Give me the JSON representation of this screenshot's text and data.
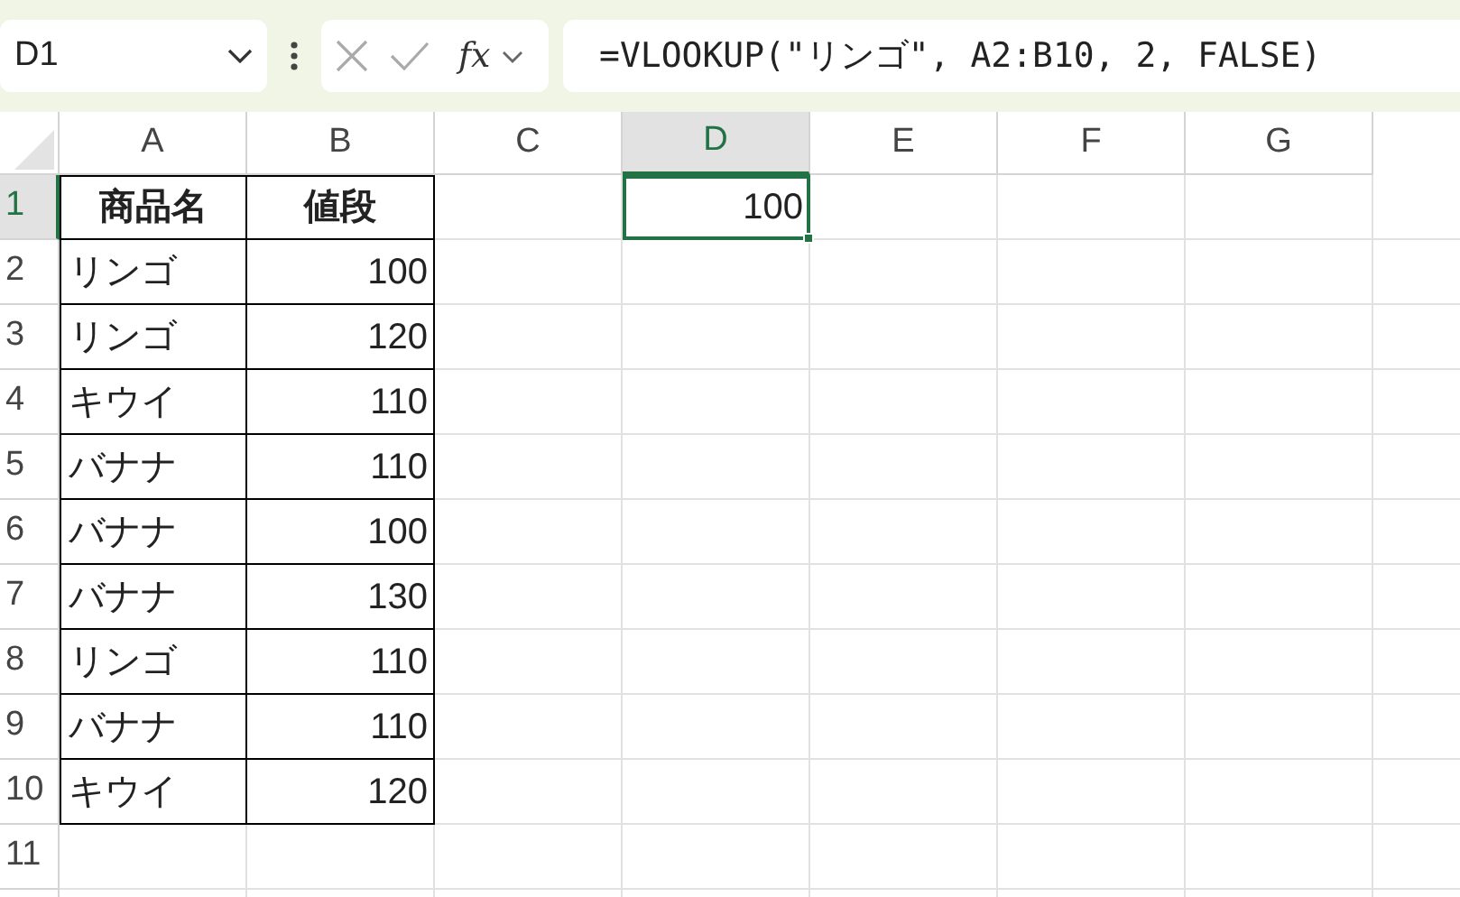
{
  "name_box": {
    "value": "D1"
  },
  "formula_bar": {
    "function_button": "fx",
    "formula": "=VLOOKUP(\"リンゴ\", A2:B10, 2, FALSE)"
  },
  "columns": [
    {
      "label": "A",
      "selected": false
    },
    {
      "label": "B",
      "selected": false
    },
    {
      "label": "C",
      "selected": false
    },
    {
      "label": "D",
      "selected": true
    },
    {
      "label": "E",
      "selected": false
    },
    {
      "label": "F",
      "selected": false
    },
    {
      "label": "G",
      "selected": false
    }
  ],
  "rows": [
    {
      "label": "1",
      "selected": true
    },
    {
      "label": "2",
      "selected": false
    },
    {
      "label": "3",
      "selected": false
    },
    {
      "label": "4",
      "selected": false
    },
    {
      "label": "5",
      "selected": false
    },
    {
      "label": "6",
      "selected": false
    },
    {
      "label": "7",
      "selected": false
    },
    {
      "label": "8",
      "selected": false
    },
    {
      "label": "9",
      "selected": false
    },
    {
      "label": "10",
      "selected": false
    },
    {
      "label": "11",
      "selected": false
    }
  ],
  "data_table": {
    "header": [
      "商品名",
      "値段"
    ],
    "rows": [
      [
        "リンゴ",
        "100"
      ],
      [
        "リンゴ",
        "120"
      ],
      [
        "キウイ",
        "110"
      ],
      [
        "バナナ",
        "110"
      ],
      [
        "バナナ",
        "100"
      ],
      [
        "バナナ",
        "130"
      ],
      [
        "リンゴ",
        "110"
      ],
      [
        "バナナ",
        "110"
      ],
      [
        "キウイ",
        "120"
      ]
    ]
  },
  "selected_cell": {
    "value": "100"
  }
}
